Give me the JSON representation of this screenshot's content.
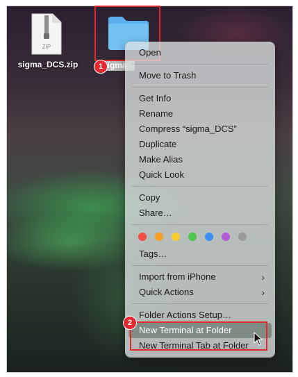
{
  "desktop": {
    "zip_file": {
      "name": "sigma_DCS.zip",
      "icon_text": "ZIP"
    },
    "folder": {
      "name": "sigma"
    }
  },
  "annotations": {
    "badge1": "1",
    "badge2": "2"
  },
  "context_menu": {
    "group1": [
      "Open"
    ],
    "group2": [
      "Move to Trash"
    ],
    "group3": [
      "Get Info",
      "Rename",
      "Compress “sigma_DCS”",
      "Duplicate",
      "Make Alias",
      "Quick Look"
    ],
    "group4": [
      "Copy",
      "Share…"
    ],
    "tag_colors": [
      "#f24d46",
      "#f5a024",
      "#f7cc2c",
      "#4cc64e",
      "#3d8df5",
      "#b35ad6",
      "#9a9a9a"
    ],
    "tags_label": "Tags…",
    "group6": [
      "Import from iPhone",
      "Quick Actions"
    ],
    "group7": [
      "Folder Actions Setup…",
      "New Terminal at Folder",
      "New Terminal Tab at Folder"
    ]
  }
}
